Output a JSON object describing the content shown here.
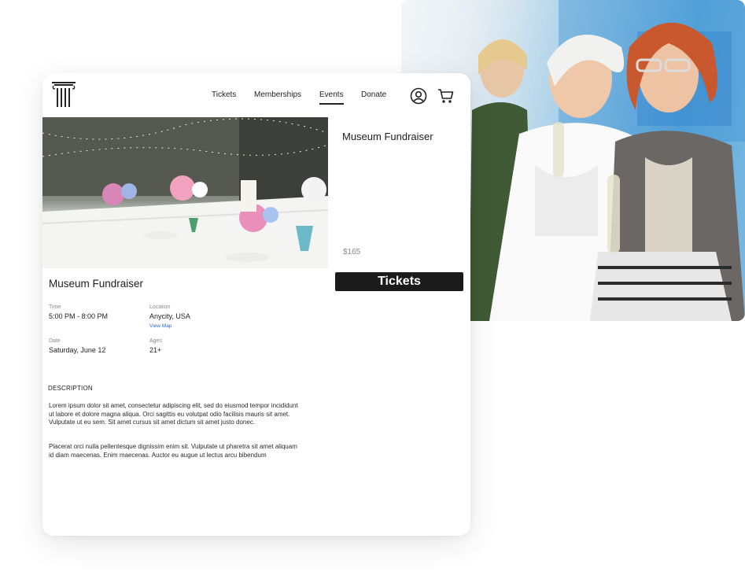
{
  "nav": {
    "tickets": "Tickets",
    "memberships": "Memberships",
    "events": "Events",
    "donate": "Donate"
  },
  "icons": {
    "logo": "column-logo-icon",
    "account": "user-circle-icon",
    "cart": "shopping-cart-icon"
  },
  "event": {
    "title": "Museum Fundraiser",
    "side_title": "Museum Fundraiser",
    "price": "$165",
    "tickets_button": "Tickets",
    "time_label": "Time",
    "time_value": "5:00 PM - 8:00 PM",
    "location_label": "Location",
    "location_value": "Anycity, USA",
    "view_map": "View Map",
    "date_label": "Date",
    "date_value": "Saturday, June 12",
    "ages_label": "Ages",
    "ages_value": "21+"
  },
  "description": {
    "heading": "DESCRIPTION",
    "paragraph_1": "Lorem ipsum dolor sit amet, consectetur adipiscing elit, sed do eiusmod tempor incididunt ut labore et dolore magna aliqua. Orci sagittis eu volutpat odio facilisis mauris sit amet. Vulputate ut eu sem. Sit amet cursus sit amet dictum sit amet justo donec.",
    "paragraph_2": "Placerat orci nulla pellentesque dignissim enim sit. Vulputate ut pharetra sit amet aliquam id diam maecenas. Enim maecenas. Auctor eu augue ut lectus arcu bibendum"
  },
  "colors": {
    "button": "#1b1b1b",
    "link": "#2d6bd1",
    "muted": "#8a8a8a"
  }
}
